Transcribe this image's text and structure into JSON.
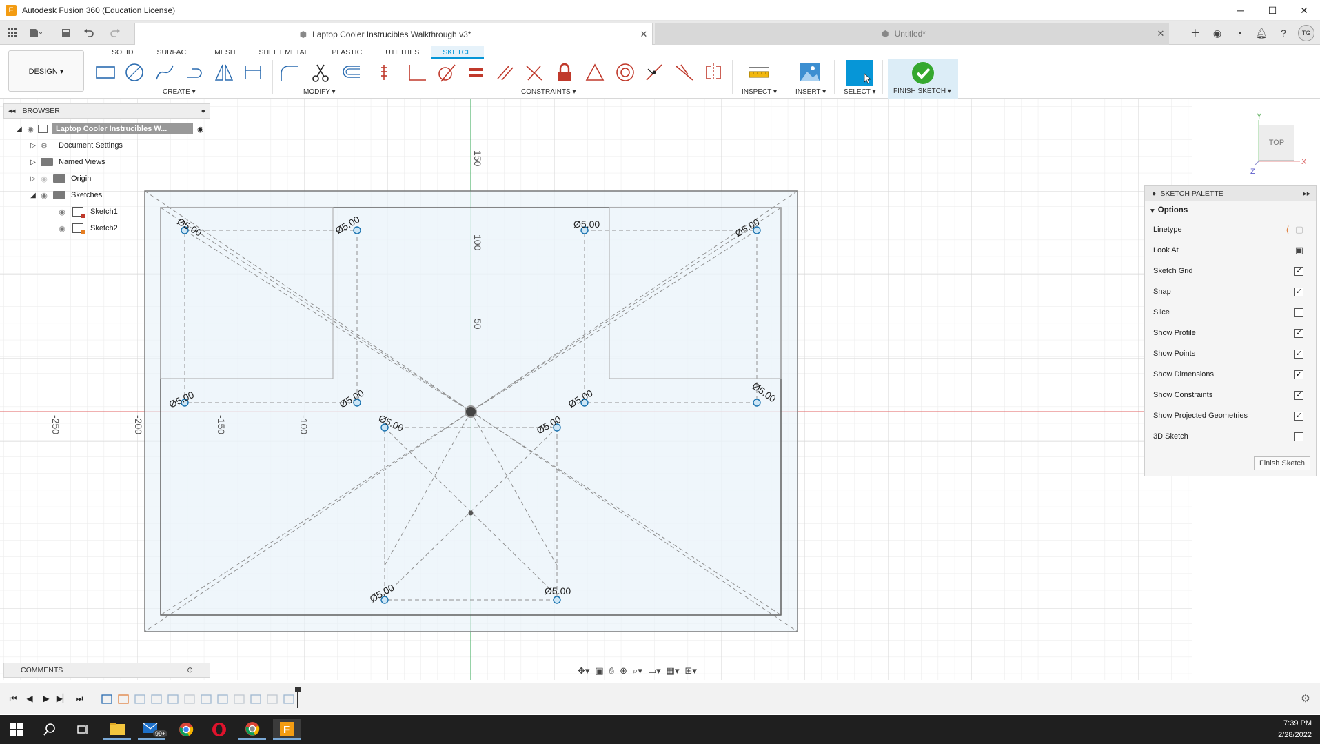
{
  "window": {
    "title": "Autodesk Fusion 360 (Education License)",
    "app_icon": "F",
    "minimize": "─",
    "maximize": "☐",
    "close": "✕"
  },
  "doc_tabs": [
    {
      "label": "Laptop Cooler Instrucibles Walkthrough v3*",
      "active": true
    },
    {
      "label": "Untitled*",
      "active": false
    }
  ],
  "user_initials": "TG",
  "workspace": {
    "label": "DESIGN ▾"
  },
  "ribbon_tabs": [
    "SOLID",
    "SURFACE",
    "MESH",
    "SHEET METAL",
    "PLASTIC",
    "UTILITIES",
    "SKETCH"
  ],
  "active_ribbon_tab": "SKETCH",
  "ribbon_groups": {
    "create": "CREATE ▾",
    "modify": "MODIFY ▾",
    "constraints": "CONSTRAINTS ▾",
    "inspect": "INSPECT ▾",
    "insert": "INSERT ▾",
    "select": "SELECT ▾",
    "finish": "FINISH SKETCH ▾"
  },
  "browser": {
    "header": "BROWSER",
    "root": "Laptop Cooler Instrucibles W...",
    "items": [
      {
        "label": "Document Settings",
        "icon": "gear-icon"
      },
      {
        "label": "Named Views",
        "icon": "folder-icon"
      },
      {
        "label": "Origin",
        "icon": "folder-icon"
      },
      {
        "label": "Sketches",
        "icon": "folder-icon"
      }
    ],
    "sketches": [
      "Sketch1",
      "Sketch2"
    ]
  },
  "comments": {
    "header": "COMMENTS"
  },
  "viewcube": {
    "face": "TOP",
    "axis_y": "Y",
    "axis_x": "X",
    "axis_z": "Z"
  },
  "axis_labels": {
    "v150": "150",
    "v100": "100",
    "v50": "50",
    "h250": "-250",
    "h200": "-200",
    "h150": "-150",
    "h100": "-100"
  },
  "dimension_label": "Ø5.00",
  "sketch_palette": {
    "header": "SKETCH PALETTE",
    "section": "Options",
    "linetype": "Linetype",
    "look_at": "Look At",
    "options": [
      {
        "label": "Sketch Grid",
        "checked": true
      },
      {
        "label": "Snap",
        "checked": true
      },
      {
        "label": "Slice",
        "checked": false
      },
      {
        "label": "Show Profile",
        "checked": true
      },
      {
        "label": "Show Points",
        "checked": true
      },
      {
        "label": "Show Dimensions",
        "checked": true
      },
      {
        "label": "Show Constraints",
        "checked": true
      },
      {
        "label": "Show Projected Geometries",
        "checked": true
      },
      {
        "label": "3D Sketch",
        "checked": false
      }
    ],
    "finish_button": "Finish Sketch"
  },
  "taskbar": {
    "badge": "99+",
    "time": "7:39 PM",
    "date": "2/28/2022"
  }
}
